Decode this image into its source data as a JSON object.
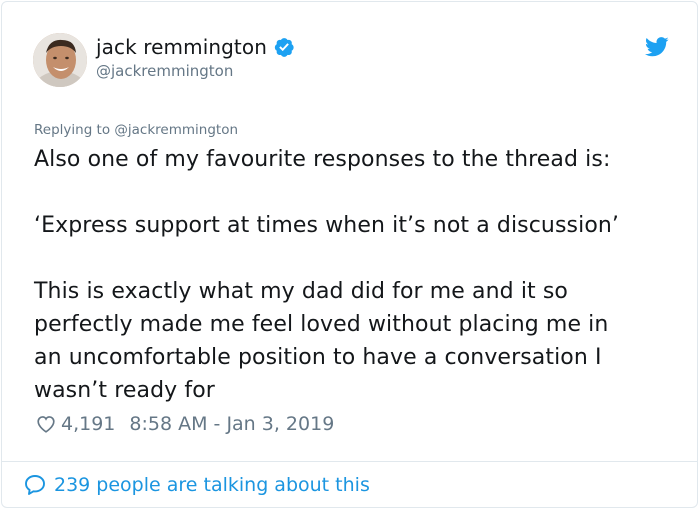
{
  "author": {
    "display_name": "jack remmington",
    "handle": "@jackremmington",
    "verified": true,
    "avatar_icon": "profile-photo"
  },
  "tweet": {
    "replying_to": "Replying to @jackremmington",
    "paragraphs": [
      [
        "Also one of my favourite responses to the thread is:"
      ],
      [
        "‘Express support at times when it’s not a discussion’"
      ],
      [
        "This is exactly what my dad did for me and it so",
        "perfectly made me feel loved without placing me in",
        "an uncomfortable position to have a conversation I",
        "wasn’t ready for"
      ]
    ],
    "likes": "4,191",
    "timestamp": "8:58 AM - Jan 3, 2019"
  },
  "footer": {
    "talking_label": "239 people are talking about this"
  },
  "colors": {
    "text": "#14171a",
    "secondary": "#657786",
    "brand_blue": "#1da1f2",
    "link_blue": "#1b95e0",
    "border": "#e1e8ed"
  },
  "icons": {
    "verified": "verified-badge-icon",
    "platform": "twitter-bird-icon",
    "like": "heart-icon",
    "comments": "speech-bubble-icon"
  }
}
